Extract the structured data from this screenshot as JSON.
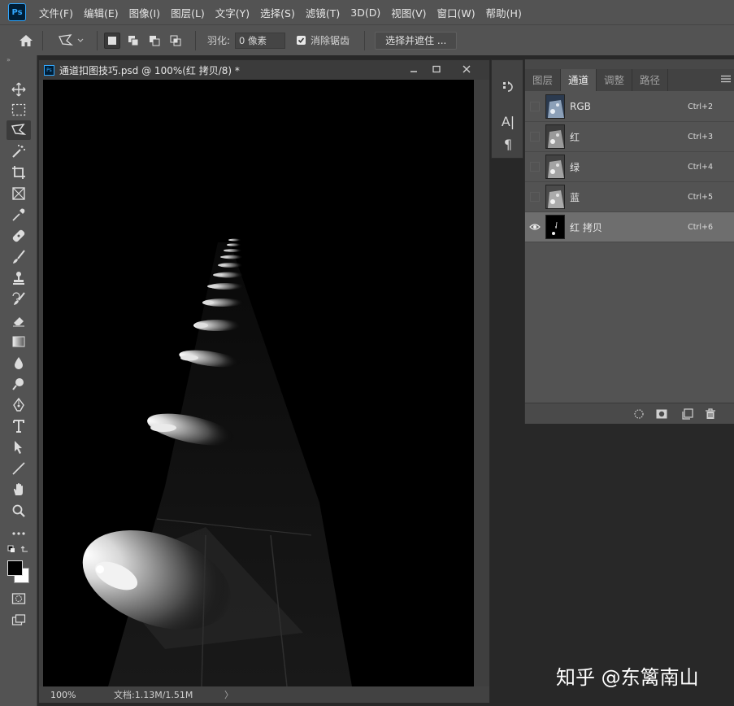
{
  "menubar": {
    "logo": "Ps",
    "items": [
      "文件(F)",
      "编辑(E)",
      "图像(I)",
      "图层(L)",
      "文字(Y)",
      "选择(S)",
      "滤镜(T)",
      "3D(D)",
      "视图(V)",
      "窗口(W)",
      "帮助(H)"
    ]
  },
  "options": {
    "feather_label": "羽化:",
    "feather_value": "0 像素",
    "antialias_label": "消除锯齿",
    "antialias_checked": true,
    "select_mask_label": "选择并遮住 ..."
  },
  "document": {
    "icon": "Ps",
    "title": "通道扣图技巧.psd @ 100%(红 拷贝/8) *",
    "zoom": "100%",
    "doc_size": "文档:1.13M/1.51M",
    "status_arrow": "〉"
  },
  "panel": {
    "tabs": [
      {
        "label": "图层",
        "active": false
      },
      {
        "label": "通道",
        "active": true
      },
      {
        "label": "调整",
        "active": false
      },
      {
        "label": "路径",
        "active": false
      }
    ],
    "channels": [
      {
        "name": "RGB",
        "shortcut": "Ctrl+2",
        "visible": false,
        "selected": false,
        "thumb": "color"
      },
      {
        "name": "红",
        "shortcut": "Ctrl+3",
        "visible": false,
        "selected": false,
        "thumb": "gray"
      },
      {
        "name": "绿",
        "shortcut": "Ctrl+4",
        "visible": false,
        "selected": false,
        "thumb": "gray"
      },
      {
        "name": "蓝",
        "shortcut": "Ctrl+5",
        "visible": false,
        "selected": false,
        "thumb": "gray"
      },
      {
        "name": "红 拷贝",
        "shortcut": "Ctrl+6",
        "visible": true,
        "selected": true,
        "thumb": "dark"
      }
    ]
  },
  "mini_panel": {
    "char_label": "A|",
    "para_label": "¶"
  },
  "watermark": "知乎 @东篱南山",
  "colors": {
    "chrome": "#535353",
    "workspace": "#282828",
    "selected_row": "#6e6e6e",
    "ps_blue": "#31a8ff"
  }
}
